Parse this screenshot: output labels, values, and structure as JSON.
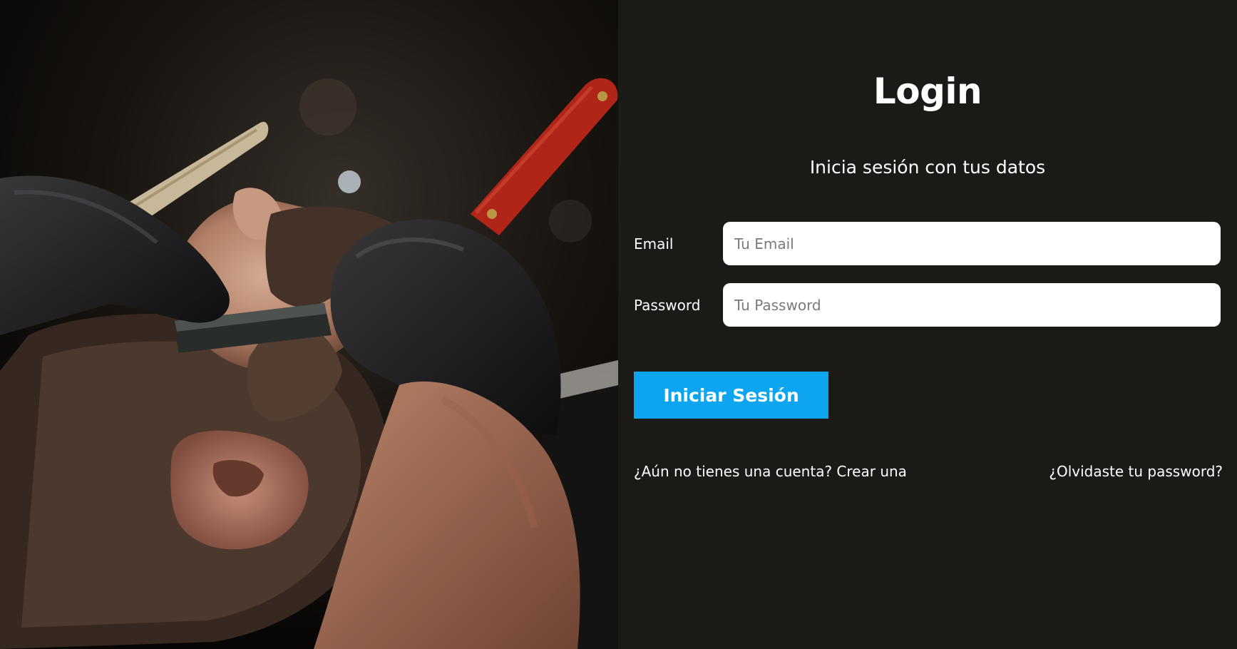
{
  "login": {
    "title": "Login",
    "subtitle": "Inicia sesión con tus datos",
    "email": {
      "label": "Email",
      "placeholder": "Tu Email",
      "value": ""
    },
    "password": {
      "label": "Password",
      "placeholder": "Tu Password",
      "value": ""
    },
    "submit_label": "Iniciar Sesión",
    "register_link": "¿Aún no tienes una cuenta? Crear una",
    "forgot_link": "¿Olvidaste tu password?"
  },
  "hero_image": {
    "subject": "barber-shaving-beard-photo"
  },
  "colors": {
    "panel_background": "#1b1a17",
    "button_background": "#0ea5f0",
    "text": "#ffffff",
    "input_background": "#ffffff",
    "placeholder": "#7a7a7a"
  }
}
